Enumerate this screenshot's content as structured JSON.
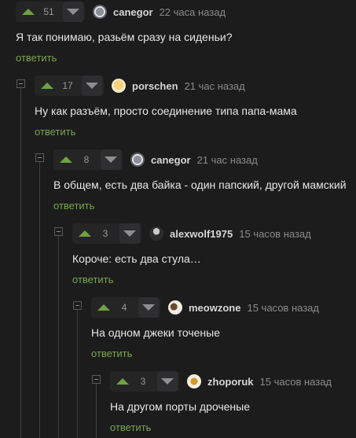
{
  "reply_label": "ответить",
  "comments": [
    {
      "rating": "51",
      "user": "canegor",
      "time": "22 часа назад",
      "text": "Я так понимаю, разьём сразу на сиденьи?"
    },
    {
      "rating": "17",
      "user": "porschen",
      "time": "21 час назад",
      "text": "Ну как разъём, просто соединение типа папа-мама"
    },
    {
      "rating": "8",
      "user": "canegor",
      "time": "21 час назад",
      "text": "В общем, есть два байка - один папский, другой мамский"
    },
    {
      "rating": "3",
      "user": "alexwolf1975",
      "time": "15 часов назад",
      "text": "Короче: есть два стула…"
    },
    {
      "rating": "4",
      "user": "meowzone",
      "time": "15 часов назад",
      "text": "На одном джеки точеные"
    },
    {
      "rating": "3",
      "user": "zhoporuk",
      "time": "15 часов назад",
      "text": "На другом порты дроченые"
    }
  ],
  "icons": {
    "upvote": "arrow-up-icon",
    "downvote": "arrow-down-icon",
    "collapse": "collapse-minus-icon",
    "vote_up_color": "#70a243",
    "reply_color": "#7aa64c"
  }
}
